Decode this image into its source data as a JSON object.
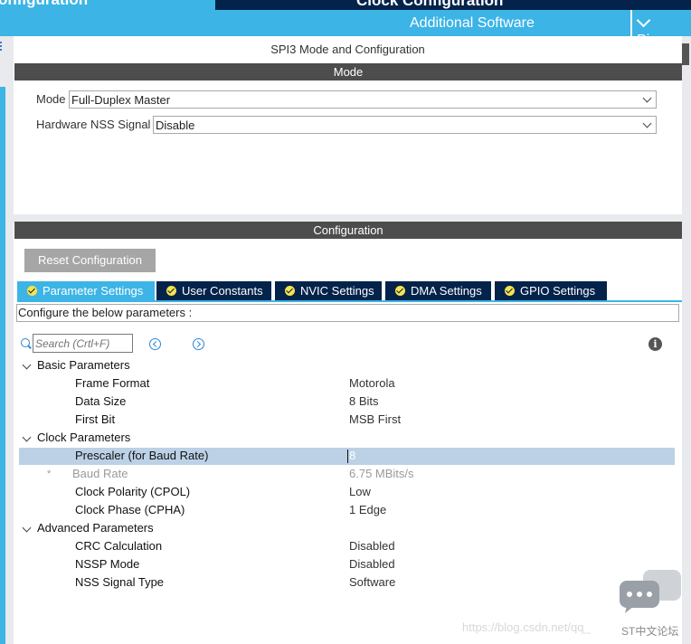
{
  "top_tabs": {
    "active_label": "onfiguration",
    "clock_label": "Clock Configuration"
  },
  "subbar": {
    "additional_software": "Additional Software",
    "pinout": "Pinou"
  },
  "panel": {
    "title": "SPI3 Mode and Configuration",
    "mode_header": "Mode",
    "config_header": "Configuration"
  },
  "mode": {
    "mode_label": "Mode",
    "mode_value": "Full-Duplex Master",
    "nss_label": "Hardware NSS Signal",
    "nss_value": "Disable"
  },
  "config": {
    "reset_button": "Reset Configuration",
    "tabs": [
      {
        "label": "Parameter Settings",
        "active": true
      },
      {
        "label": "User Constants",
        "active": false
      },
      {
        "label": "NVIC Settings",
        "active": false
      },
      {
        "label": "DMA Settings",
        "active": false
      },
      {
        "label": "GPIO Settings",
        "active": false
      }
    ],
    "description": "Configure the below parameters :",
    "search_placeholder": "Search (Crtl+F)"
  },
  "parameters": [
    {
      "group": "Basic Parameters",
      "items": [
        {
          "name": "Frame Format",
          "value": "Motorola"
        },
        {
          "name": "Data Size",
          "value": "8 Bits"
        },
        {
          "name": "First Bit",
          "value": "MSB First"
        }
      ]
    },
    {
      "group": "Clock Parameters",
      "items": [
        {
          "name": "Prescaler (for Baud Rate)",
          "value": "8",
          "selected": true
        },
        {
          "name": "Baud Rate",
          "value": "6.75 MBits/s",
          "readonly": true,
          "marker": "*"
        },
        {
          "name": "Clock Polarity (CPOL)",
          "value": "Low"
        },
        {
          "name": "Clock Phase (CPHA)",
          "value": "1 Edge"
        }
      ]
    },
    {
      "group": "Advanced Parameters",
      "items": [
        {
          "name": "CRC Calculation",
          "value": "Disabled"
        },
        {
          "name": "NSSP Mode",
          "value": "Disabled"
        },
        {
          "name": "NSS Signal Type",
          "value": "Software"
        }
      ]
    }
  ],
  "watermark": {
    "url": "https://blog.csdn.net/qq_",
    "forum": "ST中文论坛"
  },
  "colors": {
    "navy": "#03234b",
    "accent_blue": "#3cb4e6",
    "header_grey": "#4d4d4d",
    "selection": "#bcd1e6"
  }
}
